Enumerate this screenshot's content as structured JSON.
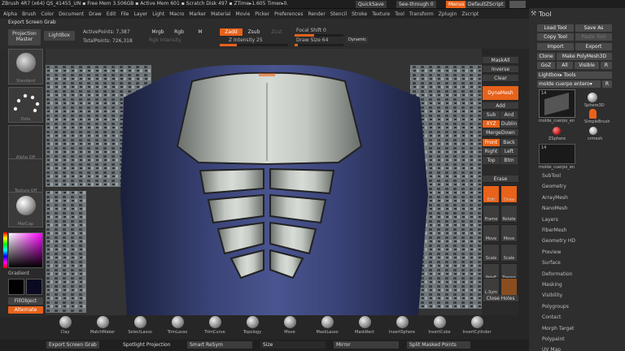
{
  "titlebar": {
    "title": "ZBrush 4R7 (x64)  QS_41455_UN  ▪ Free Mem 3.506GB ▪ Active Mem 601 ▪ Scratch Disk 497 ▪ ZTime▸1.605 Timer▸0.",
    "quicksave": "QuickSave",
    "seethrough": "See-through 0",
    "menus": "Menus",
    "script": "DefaultZScript"
  },
  "menu": [
    "Alpha",
    "Brush",
    "Color",
    "Document",
    "Draw",
    "Edit",
    "File",
    "Layer",
    "Light",
    "Macro",
    "Marker",
    "Material",
    "Movie",
    "Picker",
    "Preferences",
    "Render",
    "Stencil",
    "Stroke",
    "Texture",
    "Tool",
    "Transform",
    "Zplugin",
    "Zscript"
  ],
  "topshelf": {
    "export_screen_grab": "Export Screen Grab",
    "projection_master": "Projection Master",
    "lightbox": "LightBox",
    "active_points": "ActivePoints: 7,387",
    "total_points": "TotalPoints: 726,318",
    "mrgb": "Mrgb",
    "rgb": "Rgb",
    "m": "M",
    "zadd": "Zadd",
    "zsub": "Zsub",
    "zcut": "Zcut",
    "rgb_intensity": "Rgb Intensity",
    "z_intensity": "Z Intensity 25",
    "focal_shift": "Focal Shift 0",
    "draw_size": "Draw Size 64",
    "dynamic": "Dynamic",
    "z_intensity_level": 0.25,
    "draw_size_level": 0.06
  },
  "leftshelf": {
    "standard": "Standard",
    "dots": "Dots",
    "alpha_off": "Alpha Off",
    "texture_off": "Texture Off",
    "matcap": "MatCap",
    "gradient": "Gradient",
    "fillobject": "FillObject",
    "alternate": "Alternate"
  },
  "rightshelf": {
    "maskall": "MaskAll",
    "inverse": "Inverse",
    "clear": "Clear",
    "dynamesh": "DynaMesh",
    "add": "Add",
    "sub": "Sub",
    "and": "And",
    "xyz": "XYZ",
    "dublin": "Dublin",
    "mergedown": "MergeDown",
    "front": "Front",
    "back": "Back",
    "right": "Right",
    "left": "Left",
    "top": "Top",
    "btm": "Btm",
    "erase": "Erase",
    "edit": "Edit",
    "draw": "Draw",
    "frame": "Frame",
    "rotate": "Rotate",
    "move": "Move",
    "zmove": "Move",
    "scale": "Scale",
    "zscale": "Scale",
    "polyf": "PolyF",
    "transp": "Transp",
    "lsym": "L.Sym",
    "close_holes": "Close Holes"
  },
  "toolpanel": {
    "title": "Tool",
    "load_tool": "Load Tool",
    "save_as": "Save As",
    "copy_tool": "Copy Tool",
    "paste_tool": "Paste Tool",
    "import": "Import",
    "export": "Export",
    "clone": "Clone",
    "make_polymesh": "Make PolyMesh3D",
    "goz": "GoZ",
    "all": "All",
    "visible": "Visible",
    "r": "R",
    "lightbox_tools": "Lightbox▸ Tools",
    "molde": "molde cuerpo entero▾",
    "count": "14",
    "thumb_mold": "molde_cuerpo_en",
    "sphere3d": "Sphere3D",
    "simplebrush": "SimpleBrush",
    "zsphere": "ZSphere",
    "crmesh": "crmesh",
    "thumb_mold2": "molde_cuerpo_en",
    "count2": "14",
    "sections": [
      "SubTool",
      "Geometry",
      "ArrayMesh",
      "NanoMesh",
      "Layers",
      "FiberMesh",
      "Geometry HD",
      "Preview",
      "Surface",
      "Deformation",
      "Masking",
      "Visibility",
      "Polygroups",
      "Contact",
      "Morph Target",
      "Polypaint",
      "UV Map"
    ]
  },
  "bottomshelf": {
    "tools": [
      "Clay",
      "MatchMaker",
      "SelectLasso",
      "TrimLasso",
      "TrimCurve",
      "Topology",
      "Move",
      "MaskLasso",
      "MaskRect",
      "InsertSphere",
      "InsertCube",
      "InsertCylinder"
    ]
  },
  "statusbar": {
    "export_screen_grab": "Export Screen Grab",
    "spotlight_projection": "Spotlight Projection",
    "smart_resym": "Smart ReSym",
    "size": "Size",
    "mirror": "Mirror",
    "split_masked": "Split Masked Points"
  },
  "colors": {
    "accent": "#e8621a",
    "panel": "#2e2e2e",
    "suit": "#2c3560",
    "armor": "#b8bcb8"
  }
}
